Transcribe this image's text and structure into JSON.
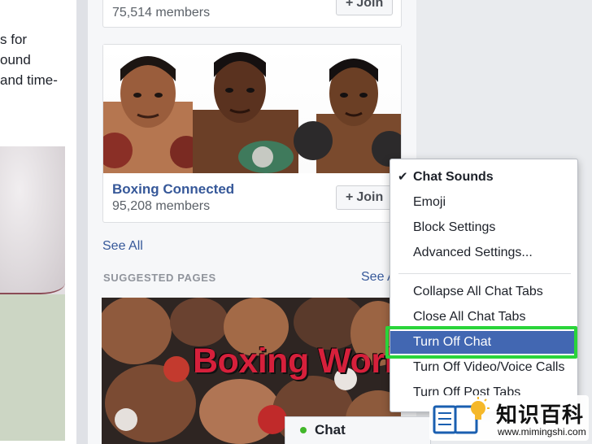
{
  "left_column": {
    "snippet": "s for\nound\nand time-"
  },
  "top_group": {
    "members": "75,514 members",
    "join_label": "Join"
  },
  "boxing_group": {
    "title": "Boxing Connected",
    "members": "95,208 members",
    "join_label": "Join"
  },
  "groups_see_all": "See All",
  "suggested_pages": {
    "header": "SUGGESTED PAGES",
    "see_link": "See A",
    "banner_text": "Boxing World"
  },
  "chat_menu": {
    "items": [
      {
        "label": "Chat Sounds",
        "checked": true,
        "bold": true
      },
      {
        "label": "Emoji"
      },
      {
        "label": "Block Settings"
      },
      {
        "label": "Advanced Settings..."
      },
      {
        "label": "Collapse All Chat Tabs"
      },
      {
        "label": "Close All Chat Tabs"
      },
      {
        "label": "Turn Off Chat",
        "selected": true
      },
      {
        "label": "Turn Off Video/Voice Calls"
      },
      {
        "label": "Turn Off Post Tabs"
      }
    ],
    "highlight_color": "#2ad43a",
    "selected_color": "#4267b2"
  },
  "chat_bar": {
    "label": "Chat",
    "status_color": "#42b72a"
  },
  "watermark": {
    "text": "知识百科",
    "url": "www.mimingshi.com"
  },
  "colors": {
    "link": "#365899",
    "page_bg": "#e9ebee"
  }
}
